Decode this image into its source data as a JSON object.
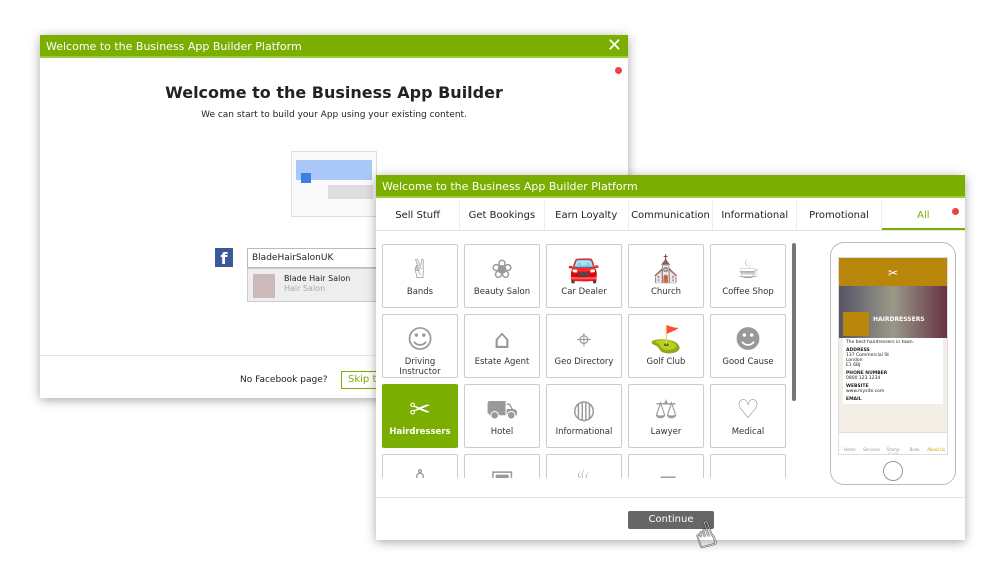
{
  "back_dialog": {
    "title": "Welcome to the Business App Builder Platform",
    "heading": "Welcome to the Business App Builder",
    "subheading": "We can start to build your App using your existing content.",
    "facebook_input": "BladeHairSalonUK",
    "suggestion": {
      "name": "Blade Hair Salon",
      "category": "Hair Salon"
    },
    "no_facebook": "No Facebook page?",
    "skip_label": "Skip t"
  },
  "front_dialog": {
    "title": "Welcome to the Business App Builder Platform",
    "tabs": [
      {
        "label": "Sell Stuff"
      },
      {
        "label": "Get Bookings"
      },
      {
        "label": "Earn Loyalty"
      },
      {
        "label": "Communication"
      },
      {
        "label": "Informational"
      },
      {
        "label": "Promotional"
      },
      {
        "label": "All",
        "active": true
      }
    ],
    "categories": [
      {
        "label": "Bands",
        "icon": "✌"
      },
      {
        "label": "Beauty Salon",
        "icon": "❀"
      },
      {
        "label": "Car Dealer",
        "icon": "🚘"
      },
      {
        "label": "Church",
        "icon": "⛪"
      },
      {
        "label": "Coffee Shop",
        "icon": "☕"
      },
      {
        "label": "Driving Instructor",
        "icon": "☺"
      },
      {
        "label": "Estate Agent",
        "icon": "⌂"
      },
      {
        "label": "Geo Directory",
        "icon": "⌖"
      },
      {
        "label": "Golf Club",
        "icon": "⛳"
      },
      {
        "label": "Good Cause",
        "icon": "☻"
      },
      {
        "label": "Hairdressers",
        "icon": "✂",
        "selected": true
      },
      {
        "label": "Hotel",
        "icon": "⛟"
      },
      {
        "label": "Informational",
        "icon": "◍"
      },
      {
        "label": "Lawyer",
        "icon": "⚖"
      },
      {
        "label": "Medical",
        "icon": "♡"
      },
      {
        "label": "",
        "icon": "♙"
      },
      {
        "label": "",
        "icon": "▣"
      },
      {
        "label": "",
        "icon": "♨"
      },
      {
        "label": "",
        "icon": "▱"
      },
      {
        "label": "",
        "icon": "☁"
      }
    ],
    "preview": {
      "business": "HAIRDRESSERS",
      "tagline": "The best hairdressers in town.",
      "address_label": "ADDRESS",
      "address": [
        "137 Commercial St",
        "London",
        "E1 6BJ"
      ],
      "phone_label": "PHONE NUMBER",
      "phone": "0800 123 1234",
      "website_label": "WEBSITE",
      "website": "www.mysite.com",
      "email_label": "EMAIL",
      "nav": [
        "Home",
        "Services",
        "Stamp Card",
        "Book",
        "About Us"
      ]
    },
    "continue_label": "Continue"
  },
  "colors": {
    "accent": "#7aae00",
    "preview_brand": "#b8860b",
    "button": "#666666"
  }
}
